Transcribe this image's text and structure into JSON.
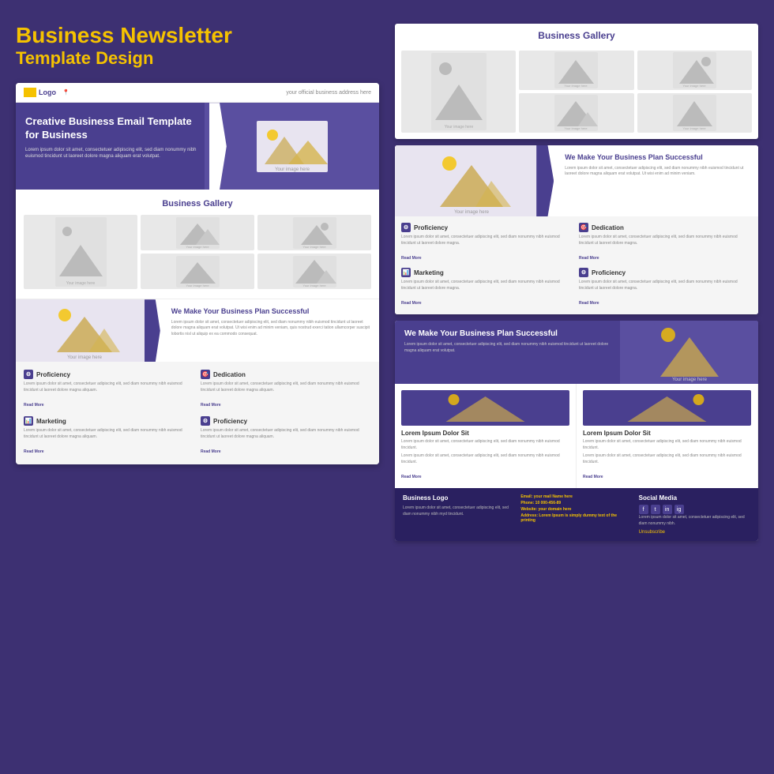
{
  "title": {
    "line1": "Business  Newsletter",
    "line2": "Template Design"
  },
  "left_newsletter": {
    "header": {
      "logo": "Logo",
      "address": "your official business address here"
    },
    "hero": {
      "heading": "Creative Business Email Template for Business",
      "body": "Lorem ipsum dolor sit amet, consectetuer adipiscing elit, sed diam nonummy nibh euismod tincidunt ut laoreet dolore magna aliquam erat volutpat.",
      "image_label": "Your image here"
    },
    "gallery": {
      "title": "Business Gallery",
      "image_label": "Your image here"
    },
    "bizplan": {
      "heading": "We Make Your Business Plan Successful",
      "body": "Lorem ipsum dolor sit amet, consectetuer adipiscing elit, sed diam nonummy nibh euismod tincidunt ut laoreet dolore magna aliquam erat volutpat. Ut wisi enim ad minim veniam, quis nostrud exerci tation ullamcorper suscipit lobortis nisl ut aliquip ex ea commodo consequat.",
      "image_label": "Your image here"
    },
    "services": [
      {
        "icon": "⚙",
        "title": "Proficiency",
        "body": "Lorem ipsum dolor sit amet, consectetuer adipiscing elit, sed diam nonummy nibh euismod tincidunt ut laoreet dolore magna aliquam.",
        "read_more": "Read More"
      },
      {
        "icon": "🎯",
        "title": "Dedication",
        "body": "Lorem ipsum dolor sit amet, consectetuer adipiscing elit, sed diam nonummy nibh euismod tincidunt ut laoreet dolore magna aliquam.",
        "read_more": "Read More"
      },
      {
        "icon": "📊",
        "title": "Marketing",
        "body": "Lorem ipsum dolor sit amet, consectetuer adipiscing elit, sed diam nonummy nibh euismod tincidunt ut laoreet dolore magna aliquam.",
        "read_more": "Read More"
      },
      {
        "icon": "⚙",
        "title": "Proficiency",
        "body": "Lorem ipsum dolor sit amet, consectetuer adipiscing elit, sed diam nonummy nibh euismod tincidunt ut laoreet dolore magna aliquam.",
        "read_more": "Read More"
      }
    ]
  },
  "right_newsletter": {
    "gallery": {
      "title": "Business Gallery",
      "image_label": "Your image here"
    },
    "plan1": {
      "image_label": "Your image here",
      "heading": "We Make Your Business Plan Successful",
      "body": "Lorem ipsum dolor sit amet, consectetuer adipiscing elit, sed diam nonummy nibh euismod tincidunt ut laoreet dolore magna aliquam erat volutpat. Ut wisi enim ad minim veniam."
    },
    "services": [
      {
        "icon": "⚙",
        "title": "Proficiency",
        "body": "Lorem ipsum dolor sit amet, consectetuer adipiscing elit, sed diam nonummy nibh euismod tincidunt ut laoreet dolore magna.",
        "read_more": "Read More"
      },
      {
        "icon": "🎯",
        "title": "Dedication",
        "body": "Lorem ipsum dolor sit amet, consectetuer adipiscing elit, sed diam nonummy nibh euismod tincidunt ut laoreet dolore magna.",
        "read_more": "Read More"
      },
      {
        "icon": "📊",
        "title": "Marketing",
        "body": "Lorem ipsum dolor sit amet, consectetuer adipiscing elit, sed diam nonummy nibh euismod tincidunt ut laoreet dolore magna.",
        "read_more": "Read More"
      },
      {
        "icon": "⚙",
        "title": "Proficiency",
        "body": "Lorem ipsum dolor sit amet, consectetuer adipiscing elit, sed diam nonummy nibh euismod tincidunt ut laoreet dolore magna.",
        "read_more": "Read More"
      }
    ],
    "plan2": {
      "heading": "We Make Your Business Plan Successful",
      "body": "Lorem ipsum dolor sit amet, consectetuer adipiscing elit, sed diam nonummy nibh euismod tincidunt ut laoreet dolore magna aliquam erat volutpat.",
      "image_label": "Your image here"
    },
    "cards": [
      {
        "title": "Lorem Ipsum Dolor Sit",
        "body1": "Lorem ipsum dolor sit amet, consectetuer adipiscing elit, sed diam nonummy nibh euismod tincidunt.",
        "body2": "Lorem ipsum dolor sit amet, consectetuer adipiscing elit, sed diam nonummy nibh euismod tincidunt.",
        "read_more": "Read More"
      },
      {
        "title": "Lorem Ipsum Dolor Sit",
        "body1": "Lorem ipsum dolor sit amet, consectetuer adipiscing elit, sed diam nonummy nibh euismod tincidunt.",
        "body2": "Lorem ipsum dolor sit amet, consectetuer adipiscing elit, sed diam nonummy nibh euismod tincidunt.",
        "read_more": "Read More"
      }
    ],
    "footer": {
      "business": {
        "title": "Business Logo",
        "body": "Lorem ipsum dolor sit amet, consectetuer adipiscing elit, sed diam nonummy nibh myd tincidunt."
      },
      "contact": {
        "email_label": "Email:",
        "email": "your mail Name here",
        "phone_label": "Phone:",
        "phone": "10 000-456-89",
        "website_label": "Website:",
        "website": "your domain here",
        "address_label": "Address:",
        "address": "Lorem Ipsum is simply dummy text of the printing"
      },
      "social": {
        "title": "Social Media",
        "body": "Lorem ipsum dolor sit amet, consectetuer adipiscing elit, sed diam nonummy nibh.",
        "unsubscribe": "Unsubscribe"
      }
    }
  }
}
